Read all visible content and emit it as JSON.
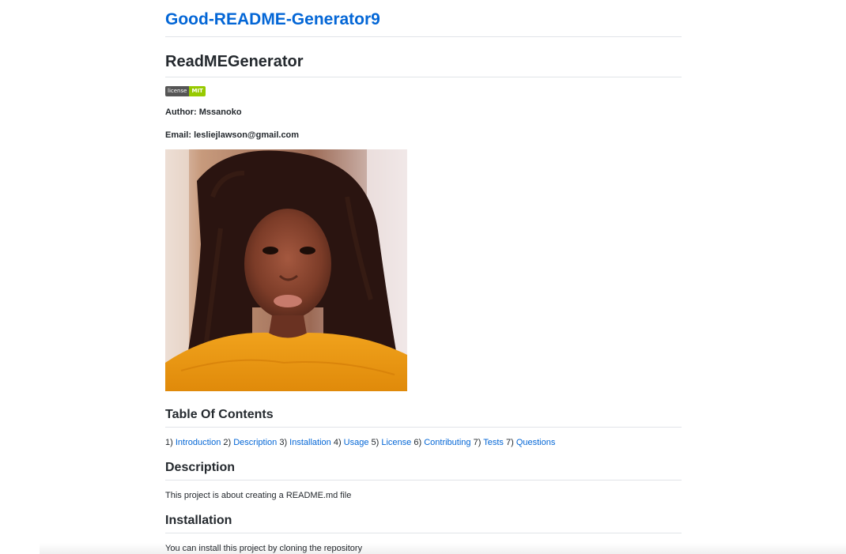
{
  "repo": {
    "title": "Good-README-Generator9"
  },
  "readme": {
    "title": "ReadMEGenerator",
    "badge": {
      "label": "license",
      "value": "MIT",
      "label_color": "#555555",
      "value_color": "#97ca00"
    },
    "author_line": "Author: Mssanoko",
    "email_line": "Email: lesliejlawson@gmail.com",
    "toc": {
      "heading": "Table Of Contents",
      "items": [
        {
          "num": "1)",
          "label": "Introduction"
        },
        {
          "num": "2)",
          "label": "Description"
        },
        {
          "num": "3)",
          "label": "Installation"
        },
        {
          "num": "4)",
          "label": "Usage"
        },
        {
          "num": "5)",
          "label": "License"
        },
        {
          "num": "6)",
          "label": "Contributing"
        },
        {
          "num": "7)",
          "label": "Tests"
        },
        {
          "num": "7)",
          "label": "Questions"
        }
      ]
    },
    "description": {
      "heading": "Description",
      "text": "This project is about creating a README.md file"
    },
    "installation": {
      "heading": "Installation",
      "text": "You can install this project by cloning the repository"
    }
  },
  "colors": {
    "link": "#0366d6",
    "text": "#24292e",
    "border": "#e1e4e8"
  }
}
